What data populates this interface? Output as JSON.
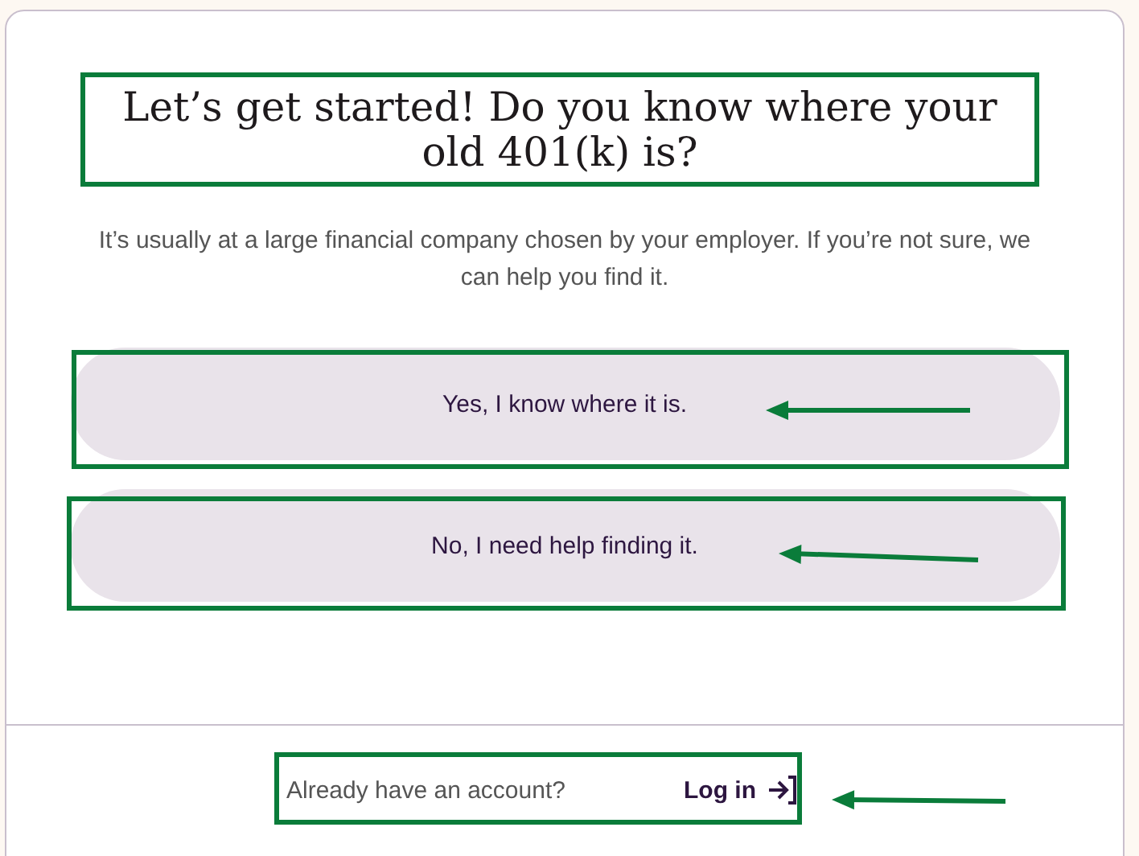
{
  "heading": "Let’s get started! Do you know where your old 401(k) is?",
  "subtitle": "It’s usually at a large financial company chosen by your employer. If you’re not sure, we can help you find it.",
  "options": [
    {
      "label": "Yes, I know where it is."
    },
    {
      "label": "No, I need help finding it."
    }
  ],
  "footer": {
    "prompt": "Already have an account?",
    "link": "Log in"
  }
}
